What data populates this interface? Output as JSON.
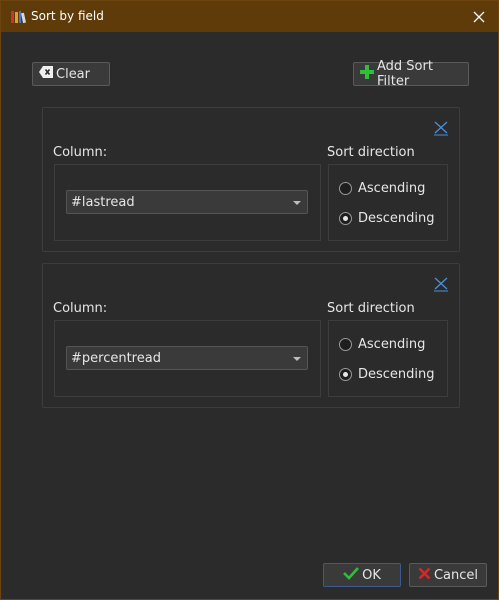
{
  "window": {
    "title": "Sort by field",
    "app_icon": "books-icon"
  },
  "toolbar": {
    "clear_label": "Clear",
    "add_label": "Add Sort Filter"
  },
  "filters": [
    {
      "column_label": "Column:",
      "column_value": "#lastread",
      "direction_label": "Sort direction",
      "ascending_label": "Ascending",
      "descending_label": "Descending",
      "selected": "Descending"
    },
    {
      "column_label": "Column:",
      "column_value": "#percentread",
      "direction_label": "Sort direction",
      "ascending_label": "Ascending",
      "descending_label": "Descending",
      "selected": "Descending"
    }
  ],
  "footer": {
    "ok_label": "OK",
    "cancel_label": "Cancel"
  },
  "colors": {
    "titlebar": "#5e3b08",
    "background": "#2b2b2b",
    "ok_check": "#2fbf3a",
    "cancel_x": "#d02a2a",
    "add_plus": "#2fbf3a",
    "remove_x": "#4a90d9"
  }
}
